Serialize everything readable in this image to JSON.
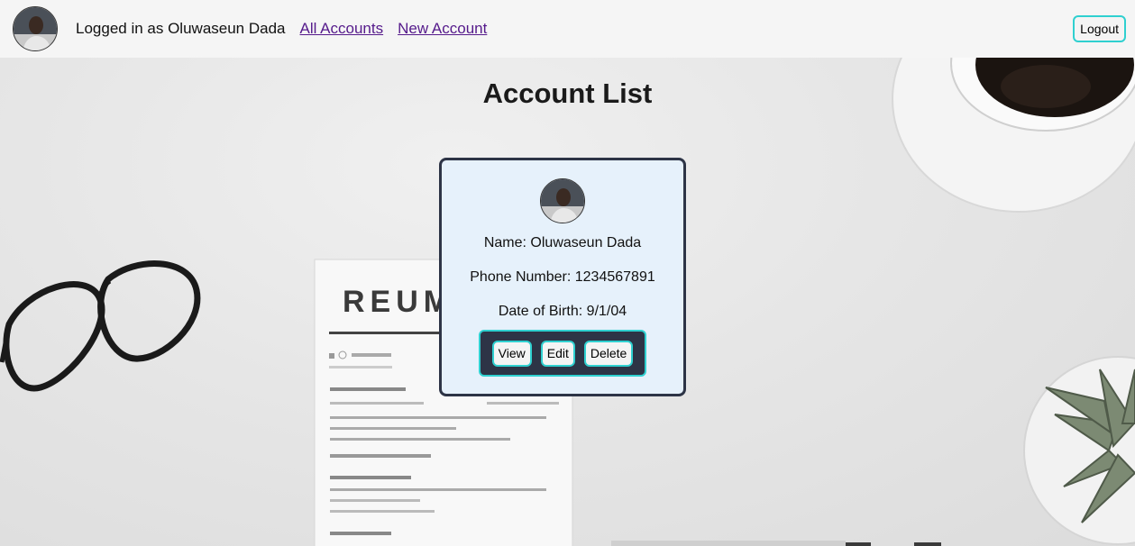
{
  "navbar": {
    "logged_in_text": "Logged in as Oluwaseun Dada",
    "links": [
      {
        "label": "All Accounts"
      },
      {
        "label": "New Account"
      }
    ],
    "logout_label": "Logout"
  },
  "main": {
    "title": "Account List",
    "account": {
      "name_line": "Name: Oluwaseun Dada",
      "phone_line": "Phone Number: 1234567891",
      "dob_line": "Date of Birth: 9/1/04",
      "actions": {
        "view_label": "View",
        "edit_label": "Edit",
        "delete_label": "Delete"
      }
    }
  },
  "background": {
    "document_heading": "REUM"
  },
  "colors": {
    "navbar_bg": "#f5f5f5",
    "link": "#551a8b",
    "accent_border": "#2fd0d0",
    "card_bg": "#e6f1fb",
    "card_border": "#2d3446"
  },
  "icons": [
    "user-avatar",
    "user-avatar"
  ]
}
